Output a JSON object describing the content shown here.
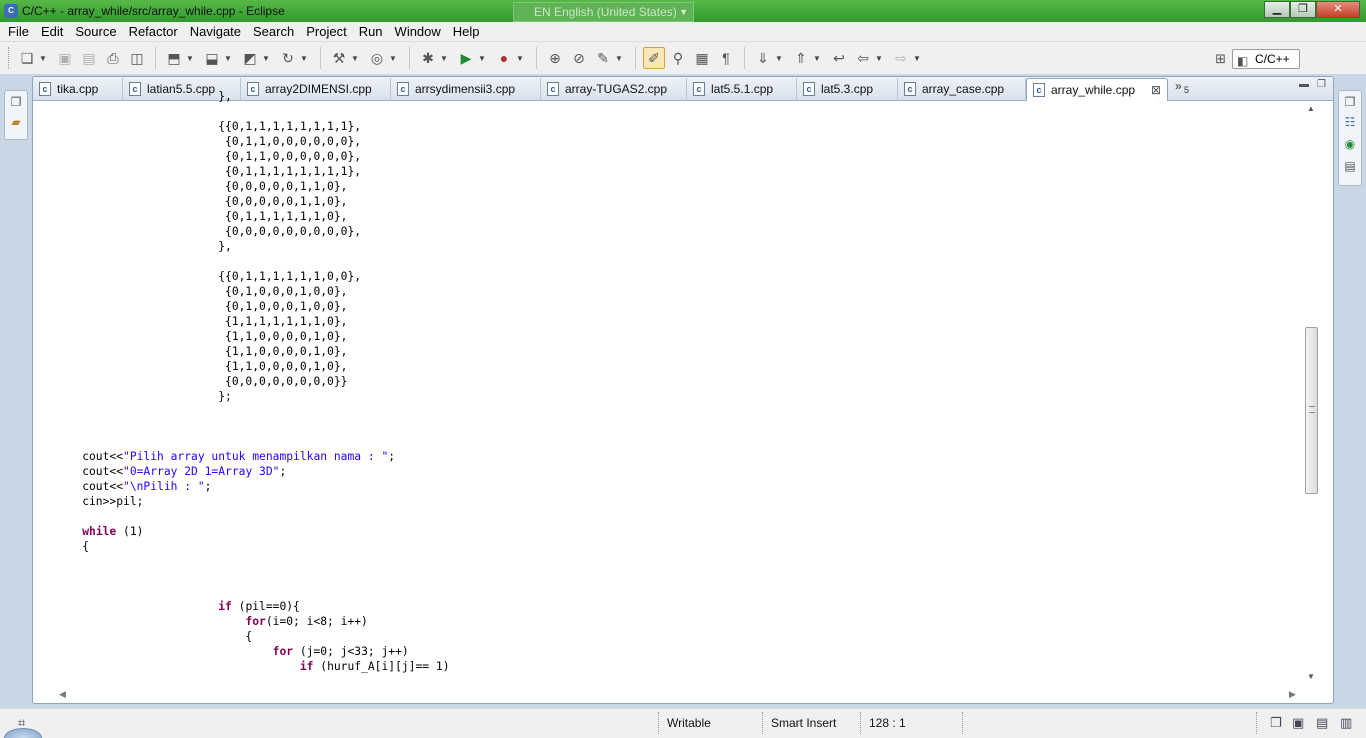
{
  "window": {
    "title": "C/C++ - array_while/src/array_while.cpp - Eclipse",
    "ime": "EN English (United States)"
  },
  "menu": [
    "File",
    "Edit",
    "Source",
    "Refactor",
    "Navigate",
    "Search",
    "Project",
    "Run",
    "Window",
    "Help"
  ],
  "toolbar": {
    "perspective": "C/C++"
  },
  "tabs": [
    {
      "label": "tika.cpp"
    },
    {
      "label": "latian5.5.cpp"
    },
    {
      "label": "array2DIMENSI.cpp"
    },
    {
      "label": "arrsydimensii3.cpp"
    },
    {
      "label": "array-TUGAS2.cpp"
    },
    {
      "label": "lat5.5.1.cpp"
    },
    {
      "label": "lat5.3.cpp"
    },
    {
      "label": "array_case.cpp"
    },
    {
      "label": "array_while.cpp"
    }
  ],
  "tab_overflow": "5",
  "code_lines": [
    "                        },",
    "",
    "                        {{0,1,1,1,1,1,1,1,1},",
    "                         {0,1,1,0,0,0,0,0,0},",
    "                         {0,1,1,0,0,0,0,0,0},",
    "                         {0,1,1,1,1,1,1,1,1},",
    "                         {0,0,0,0,0,1,1,0},",
    "                         {0,0,0,0,0,1,1,0},",
    "                         {0,1,1,1,1,1,1,0},",
    "                         {0,0,0,0,0,0,0,0,0},",
    "                        },",
    "",
    "                        {{0,1,1,1,1,1,1,0,0},",
    "                         {0,1,0,0,0,1,0,0},",
    "                         {0,1,0,0,0,1,0,0},",
    "                         {1,1,1,1,1,1,1,0},",
    "                         {1,1,0,0,0,0,1,0},",
    "                         {1,1,0,0,0,0,1,0},",
    "                         {1,1,0,0,0,0,1,0},",
    "                         {0,0,0,0,0,0,0,0}}",
    "                        };",
    "",
    "",
    "",
    "    cout<<\"Pilih array untuk menampilkan nama : \";",
    "    cout<<\"0=Array 2D 1=Array 3D\";",
    "    cout<<\"\\nPilih : \";",
    "    cin>>pil;",
    "",
    "    while (1)",
    "    {",
    "",
    "",
    "",
    "                        if (pil==0){",
    "                            for(i=0; i<8; i++)",
    "                            {",
    "                                for (j=0; j<33; j++)",
    "                                    if (huruf_A[i][j]== 1)"
  ],
  "status": {
    "writable": "Writable",
    "insert_mode": "Smart Insert",
    "position": "128 : 1"
  }
}
